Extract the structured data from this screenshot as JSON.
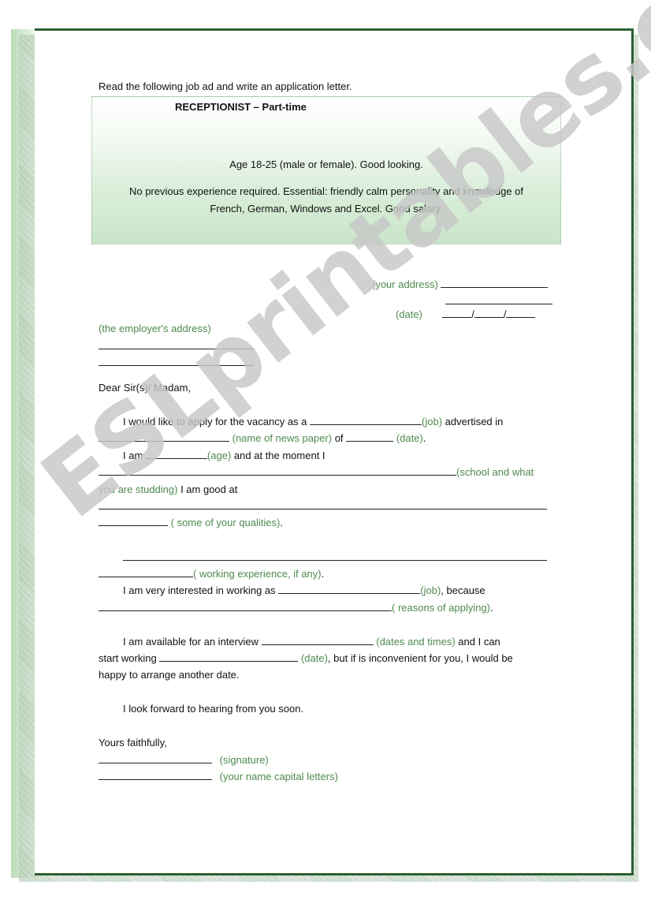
{
  "instruction": "Read the following job ad and write an application letter.",
  "job_ad": {
    "title": "RECEPTIONIST – Part-time",
    "line1": "Age 18-25 (male or female). Good looking.",
    "line2": "No previous experience required. Essential: friendly calm personality and knowledge of",
    "line3": "French, German, Windows and Excel. Good salary."
  },
  "header": {
    "your_address_hint": "(your address)",
    "date_hint": "(date)",
    "date_separator": "/",
    "employer_address_hint": "(the employer's address)"
  },
  "letter": {
    "greeting": "Dear Sir(s)/ Madam,",
    "p1_a": "I would like to apply for the vacancy as a",
    "p1_job_hint": "(job)",
    "p1_b": "advertised in",
    "p1_paper_hint": "(name of news paper)",
    "p1_of": "of",
    "p1_date_hint": "(date)",
    "p1_end": ".",
    "p2_a": "I am",
    "p2_age_hint": "(age)",
    "p2_b": "and at the moment I",
    "p2_school_hint_a": "(school and what",
    "p2_school_hint_b": "you are studding)",
    "p2_c": "I am  good at",
    "p2_qualities_hint": "( some of your qualities)",
    "p2_end": ".",
    "p3_experience_hint": "( working experience, if any)",
    "p3_end": ".",
    "p4_a": "I am very interested in working as",
    "p4_job_hint": "(job)",
    "p4_b": ", because",
    "p4_reasons_hint": "( reasons of applying)",
    "p4_end": ".",
    "p5_a": "I am available for an interview",
    "p5_times_hint": "(dates and times)",
    "p5_b": "and I can",
    "p5_c": "start working",
    "p5_date_hint": "(date)",
    "p5_d": ", but if is inconvenient for you, I would be",
    "p5_e": "happy to arrange another date.",
    "closing_line": "I look forward to hearing from you soon.",
    "sign_off": "Yours faithfully,",
    "signature_hint": "(signature)",
    "name_hint": "(your name capital letters)"
  },
  "watermark": "ESLprintables.com",
  "colors": {
    "frame_green": "#2e5e32",
    "hint_green": "#4e8a4e",
    "ad_box_green": "#c9e5c9"
  }
}
